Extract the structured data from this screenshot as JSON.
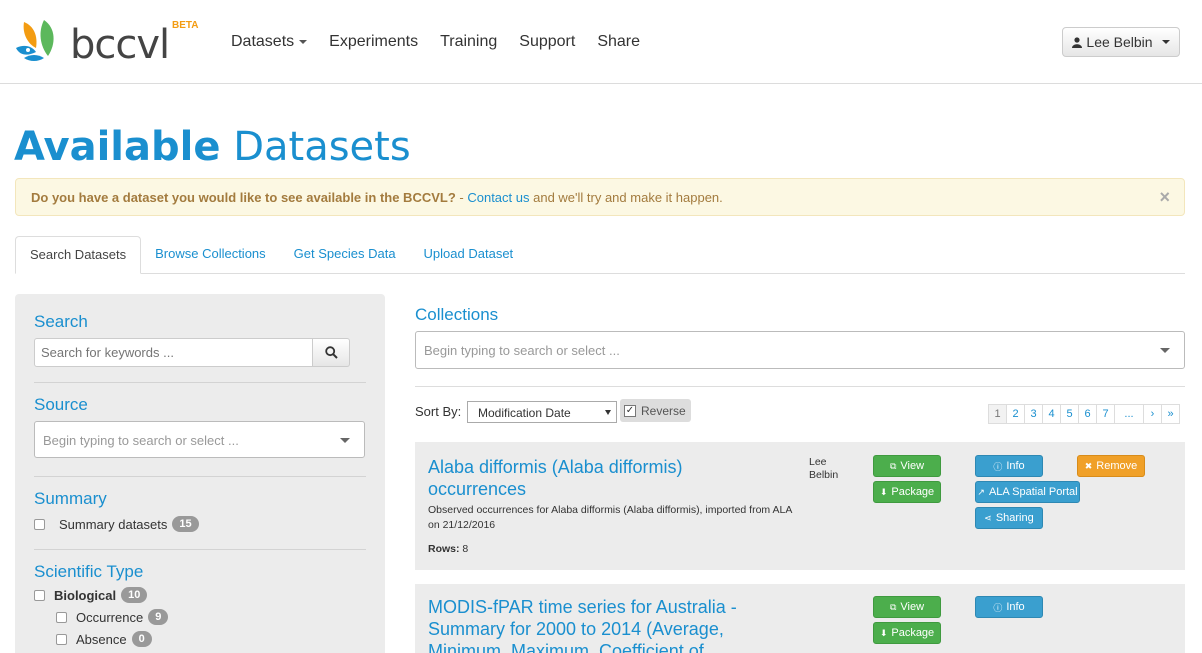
{
  "brand": {
    "name": "bccvl",
    "tag": "BETA"
  },
  "nav": {
    "items": [
      {
        "label": "Datasets",
        "dropdown": true
      },
      {
        "label": "Experiments",
        "dropdown": false
      },
      {
        "label": "Training",
        "dropdown": false
      },
      {
        "label": "Support",
        "dropdown": false
      },
      {
        "label": "Share",
        "dropdown": false
      }
    ]
  },
  "user": {
    "name": "Lee Belbin"
  },
  "page": {
    "title_bold": "Available",
    "title_light": "Datasets"
  },
  "alert": {
    "question": "Do you have a dataset you would like to see available in the BCCVL?",
    "dash": " - ",
    "link": "Contact us",
    "tail": " and we'll try and make it happen.",
    "close": "×"
  },
  "tabs": [
    {
      "label": "Search Datasets",
      "active": true
    },
    {
      "label": "Browse Collections",
      "active": false
    },
    {
      "label": "Get Species Data",
      "active": false
    },
    {
      "label": "Upload Dataset",
      "active": false
    }
  ],
  "sidebar": {
    "search": {
      "heading": "Search",
      "placeholder": "Search for keywords ..."
    },
    "source": {
      "heading": "Source",
      "placeholder": "Begin typing to search or select ..."
    },
    "summary": {
      "heading": "Summary",
      "label": "Summary datasets",
      "count": "15"
    },
    "scientific_type": {
      "heading": "Scientific Type",
      "items": [
        {
          "label": "Biological",
          "count": "10"
        },
        {
          "label": "Occurrence",
          "count": "9"
        },
        {
          "label": "Absence",
          "count": "0"
        }
      ]
    }
  },
  "collections": {
    "heading": "Collections",
    "placeholder": "Begin typing to search or select ..."
  },
  "sort": {
    "label": "Sort By:",
    "value": "Modification Date",
    "reverse_label": "Reverse",
    "reverse_checked": true
  },
  "pager": {
    "pages": [
      "1",
      "2",
      "3",
      "4",
      "5",
      "6",
      "7",
      "...",
      "›",
      "»"
    ],
    "current": "1"
  },
  "datasets": [
    {
      "title": "Alaba difformis (Alaba difformis) occurrences",
      "description": "Observed occurrences for Alaba difformis (Alaba difformis), imported from ALA on 21/12/2016",
      "rows_label": "Rows:",
      "rows": "8",
      "owner": "Lee Belbin",
      "buttons": {
        "view": "View",
        "package": "Package",
        "info": "Info",
        "remove": "Remove",
        "ala": "ALA Spatial Portal",
        "sharing": "Sharing"
      }
    },
    {
      "title": "MODIS-fPAR time series for Australia - Summary for 2000 to 2014 (Average, Minimum, Maximum, Coefficient of",
      "buttons": {
        "view": "View",
        "package": "Package",
        "info": "Info"
      }
    }
  ]
}
